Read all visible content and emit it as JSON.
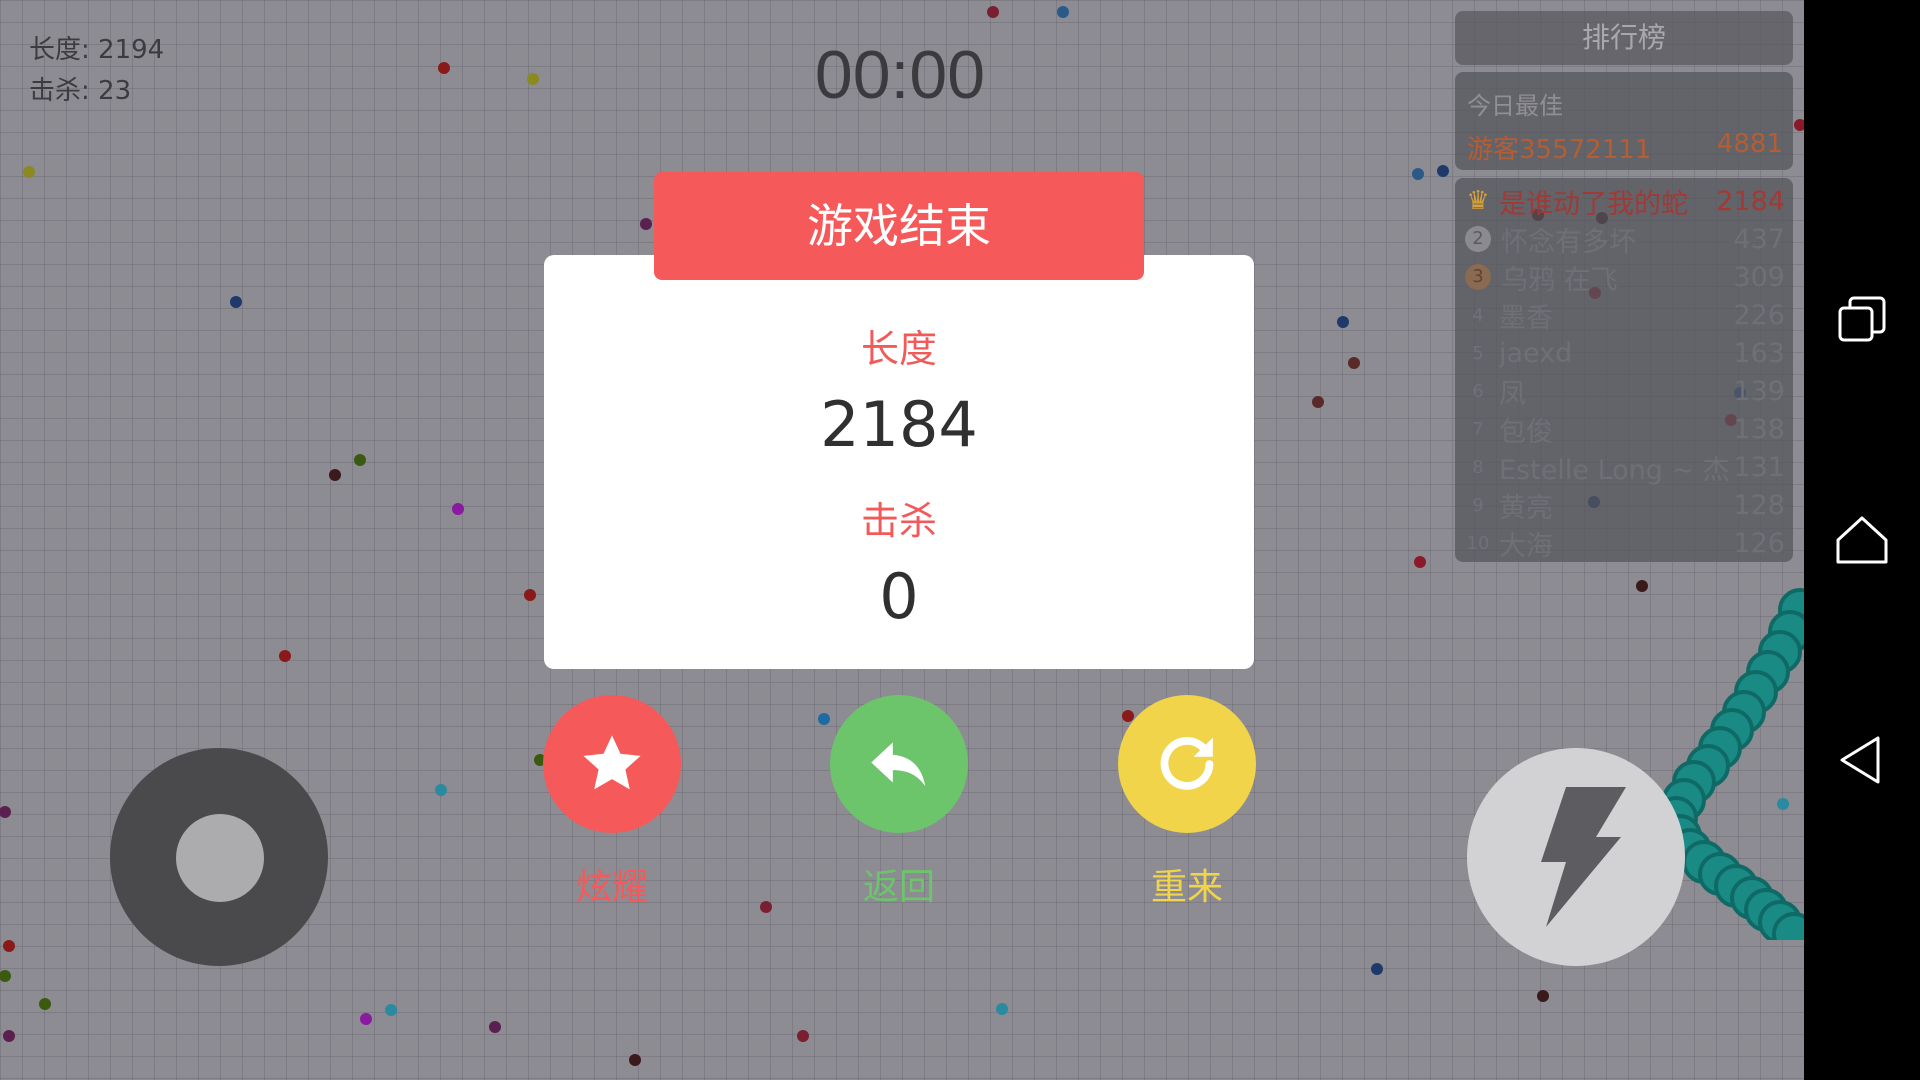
{
  "hud": {
    "length_label": "长度",
    "length_value": "2194",
    "kills_label": "击杀",
    "kills_value": "23",
    "timer": "00:00"
  },
  "leaderboard": {
    "title": "排行榜",
    "best_label": "今日最佳",
    "best_name": "游客35572111",
    "best_score": "4881",
    "entries": [
      {
        "rank": "1",
        "name": "是谁动了我的蛇",
        "score": "2184"
      },
      {
        "rank": "2",
        "name": "怀念有多坏",
        "score": "437"
      },
      {
        "rank": "3",
        "name": "乌鸦 在飞",
        "score": "309"
      },
      {
        "rank": "4",
        "name": "墨香",
        "score": "226"
      },
      {
        "rank": "5",
        "name": "jaexd",
        "score": "163"
      },
      {
        "rank": "6",
        "name": "凤",
        "score": "139"
      },
      {
        "rank": "7",
        "name": "包俊",
        "score": "138"
      },
      {
        "rank": "8",
        "name": "Estelle Long ~ 杰",
        "score": "131"
      },
      {
        "rank": "9",
        "name": "黄亮",
        "score": "128"
      },
      {
        "rank": "10",
        "name": "大海",
        "score": "126"
      }
    ]
  },
  "game_over": {
    "title": "游戏结束",
    "length_label": "长度",
    "length_value": "2184",
    "kills_label": "击杀",
    "kills_value": "0",
    "share_label": "炫耀",
    "back_label": "返回",
    "retry_label": "重来"
  },
  "icons": {
    "share": "star-icon",
    "back": "reply-arrow-icon",
    "retry": "refresh-icon",
    "boost": "lightning-icon",
    "nav_recent": "recent-apps-icon",
    "nav_home": "home-icon",
    "nav_back": "back-triangle-icon"
  },
  "colors": {
    "header_red": "#f5595a",
    "share_red": "#f5595a",
    "back_green": "#6cc56a",
    "retry_yellow": "#f2d44a",
    "snake_teal": "#1a8a85"
  }
}
